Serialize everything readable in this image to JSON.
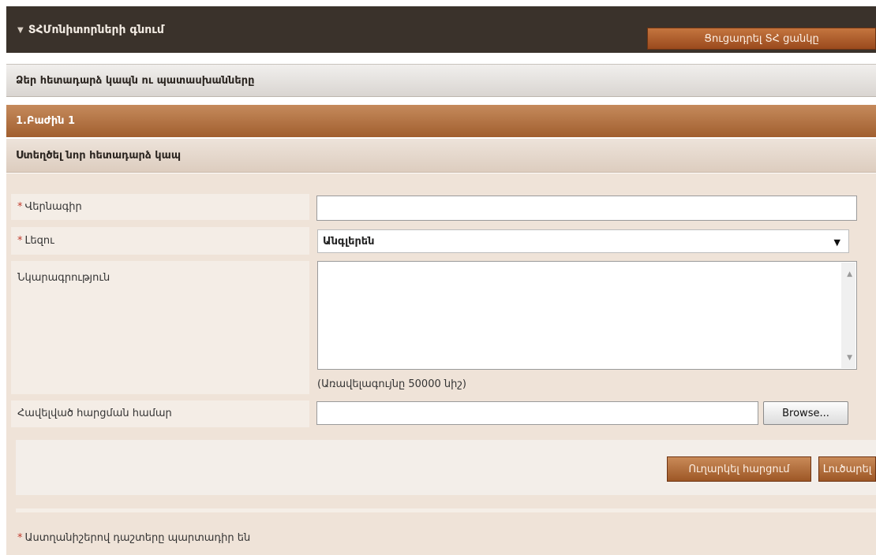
{
  "header": {
    "toggle_icon": "triangle-down-icon",
    "title": "ՏՀՄոնիտորների գնում",
    "list_link": "Ցուցադրել ՏՀ ցանկը"
  },
  "sections": {
    "qa_title": "Ձեր հետադարձ կապն ու պատասխանները",
    "lot_title": "1.Բաժին 1",
    "new_feedback_title": "Ստեղծել նոր հետադարձ կապ"
  },
  "form": {
    "required_mark": "*",
    "title_label": "Վերնագիր",
    "title_value": "",
    "language_label": "Լեզու",
    "language_value": "Անգլերեն",
    "description_label": "Նկարագրություն",
    "description_value": "",
    "description_hint": "(Առավելագույնը 50000 նիշ)",
    "attachment_label": "Հավելված հարցման համար",
    "attachment_value": "",
    "browse_label": "Browse...",
    "submit_label": "Ուղարկել հարցում",
    "cancel_label": "Լուծարել"
  },
  "footer": {
    "required_note": "Աստղանիշերով դաշտերը պարտադիր են"
  }
}
